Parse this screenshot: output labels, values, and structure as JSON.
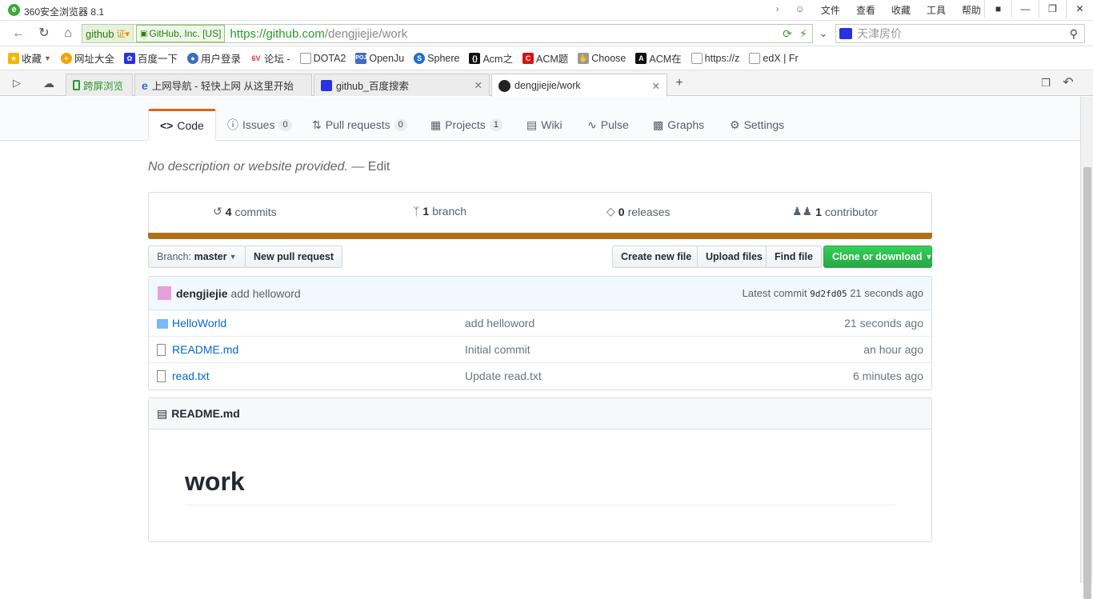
{
  "window": {
    "title": "360安全浏览器 8.1",
    "menus": [
      "文件",
      "查看",
      "收藏",
      "工具",
      "帮助"
    ]
  },
  "address": {
    "site_label": "github",
    "cert_label": "GitHub, Inc. [US]",
    "url_proto": "https://",
    "url_host": "github.com",
    "url_path": "/dengjiejie/work",
    "search_placeholder": "天津房价"
  },
  "bookmarks": [
    {
      "label": "收藏",
      "icon": "star-icon",
      "color": "#f5b800"
    },
    {
      "label": "网址大全",
      "icon": "globe-icon",
      "color": "#f5a300"
    },
    {
      "label": "百度一下",
      "icon": "baidu-paw-icon",
      "color": "#2932e1"
    },
    {
      "label": "用户登录",
      "icon": "user-icon",
      "color": "#3b6fc0"
    },
    {
      "label": "论坛 -",
      "icon": "forum-icon",
      "color": "#d33"
    },
    {
      "label": "DOTA2",
      "icon": "page-icon",
      "color": "#888"
    },
    {
      "label": "OpenJu",
      "icon": "poj-icon",
      "color": "#3a6fc0"
    },
    {
      "label": "Sphere",
      "icon": "sphere-icon",
      "color": "#1e6fd6"
    },
    {
      "label": "Acm之",
      "icon": "acm-icon",
      "color": "#111"
    },
    {
      "label": "ACM题",
      "icon": "acm-red-icon",
      "color": "#d11"
    },
    {
      "label": "Choose",
      "icon": "choose-icon",
      "color": "#999"
    },
    {
      "label": "ACM在",
      "icon": "acm-black-icon",
      "color": "#111"
    },
    {
      "label": "https://z",
      "icon": "page-icon",
      "color": "#888"
    },
    {
      "label": "edX | Fr",
      "icon": "page-icon",
      "color": "#888"
    }
  ],
  "tabs": [
    {
      "label": "跨屏浏览"
    },
    {
      "label": "上网导航 - 轻快上网 从这里开始"
    },
    {
      "label": "github_百度搜索"
    },
    {
      "label": "dengjiejie/work"
    }
  ],
  "repo_nav": [
    {
      "label": "Code",
      "count": ""
    },
    {
      "label": "Issues",
      "count": "0"
    },
    {
      "label": "Pull requests",
      "count": "0"
    },
    {
      "label": "Projects",
      "count": "1"
    },
    {
      "label": "Wiki",
      "count": ""
    },
    {
      "label": "Pulse",
      "count": ""
    },
    {
      "label": "Graphs",
      "count": ""
    },
    {
      "label": "Settings",
      "count": ""
    }
  ],
  "description": {
    "text": "No description or website provided.",
    "edit": " — Edit"
  },
  "stats": {
    "commits_num": "4",
    "commits_label": "commits",
    "branch_num": "1",
    "branch_label": "branch",
    "releases_num": "0",
    "releases_label": "releases",
    "contributor_num": "1",
    "contributor_label": "contributor",
    "language_color": "#b07219"
  },
  "toolbar": {
    "branch_prefix": "Branch:",
    "branch_name": "master",
    "new_pr": "New pull request",
    "create_file": "Create new file",
    "upload_files": "Upload files",
    "find_file": "Find file",
    "clone": "Clone or download"
  },
  "latest_commit": {
    "author": "dengjiejie",
    "message": "add helloword",
    "prefix": "Latest commit",
    "sha": "9d2fd05",
    "age": "21 seconds ago"
  },
  "files": [
    {
      "type": "folder",
      "name": "HelloWorld",
      "message": "add helloword",
      "age": "21 seconds ago"
    },
    {
      "type": "file",
      "name": "README.md",
      "message": "Initial commit",
      "age": "an hour ago"
    },
    {
      "type": "file",
      "name": "read.txt",
      "message": "Update read.txt",
      "age": "6 minutes ago"
    }
  ],
  "readme": {
    "header": "README.md",
    "heading": "work"
  }
}
